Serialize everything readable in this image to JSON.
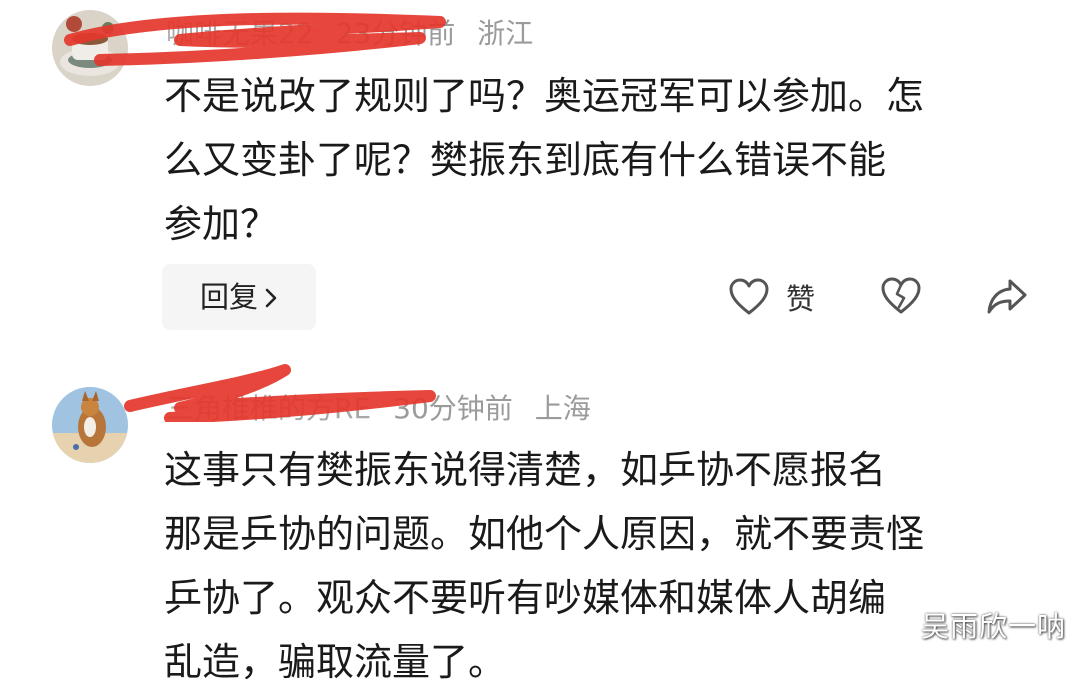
{
  "comments": [
    {
      "username": "咖啡无果22",
      "time": "23分钟前",
      "location": "浙江",
      "lines": [
        "不是说改了规则了吗？奥运冠军可以参加。怎",
        "么又变卦了呢？樊振东到底有什么错误不能",
        "参加？"
      ],
      "reply_label": "回复",
      "like_label": "赞"
    },
    {
      "username": "三角椎椎的方RE",
      "time": "30分钟前",
      "location": "上海",
      "lines": [
        "这事只有樊振东说得清楚，如乒协不愿报名",
        "那是乒协的问题。如他个人原因，就不要责怪",
        "乒协了。观众不要听有吵媒体和媒体人胡编",
        "乱造，骗取流量了。"
      ]
    }
  ],
  "icons": {
    "like": "heart-outline-icon",
    "dislike": "broken-heart-icon",
    "share": "share-arrow-icon",
    "reply_chevron": "chevron-right-icon"
  },
  "watermark": "吴雨欣一呐",
  "colors": {
    "redaction": "#e4362b",
    "meta_text": "#9b9b9b",
    "body_text": "#1a1a1a",
    "reply_bg": "#f5f5f5"
  }
}
